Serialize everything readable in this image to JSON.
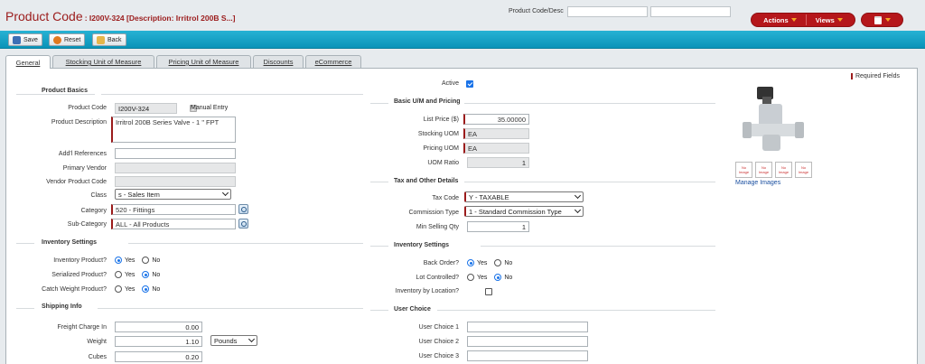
{
  "header": {
    "title": "Product Code",
    "subtitle": ": I200V-324 [Description: Irritrol 200B S...]",
    "search_label": "Product Code/Desc",
    "search_value_1": "",
    "search_value_2": ""
  },
  "actions": {
    "actions_label": "Actions",
    "views_label": "Views"
  },
  "toolbar": {
    "save": "Save",
    "reset": "Reset",
    "back": "Back"
  },
  "tabs": [
    "General",
    "Stocking Unit of Measure",
    "Pricing Unit of Measure",
    "Discounts",
    "eCommerce"
  ],
  "required_note": "Required Fields",
  "active": {
    "label": "Active",
    "checked": true
  },
  "product_basics": {
    "section": "Product Basics",
    "code_label": "Product Code",
    "code": "I200V-324",
    "manual_entry": "Manual Entry",
    "desc_label": "Product Description",
    "desc": "Irritrol 200B Series Valve - 1 \" FPT",
    "refs_label": "Add'l References",
    "refs": "",
    "vendor_label": "Primary Vendor",
    "vendor": "",
    "vpc_label": "Vendor Product Code",
    "vpc": "",
    "class_label": "Class",
    "class": "s - Sales Item",
    "category_label": "Category",
    "category": "520 - Fittings",
    "subcat_label": "Sub-Category",
    "subcat": "ALL - All Products"
  },
  "inv_left": {
    "section": "Inventory Settings",
    "inv_label": "Inventory Product?",
    "ser_label": "Serialized Product?",
    "cw_label": "Catch Weight Product?",
    "yes": "Yes",
    "no": "No",
    "inv": "Yes",
    "ser": "No",
    "cw": "No"
  },
  "shipping": {
    "section": "Shipping Info",
    "freight_label": "Freight Charge In",
    "freight": "0.00",
    "weight_label": "Weight",
    "weight": "1.10",
    "weight_unit": "Pounds",
    "cubes_label": "Cubes",
    "cubes": "0.20"
  },
  "pricing": {
    "section": "Basic U/M and Pricing",
    "list_label": "List Price ($)",
    "list": "35.00000",
    "stock_label": "Stocking UOM",
    "stock": "EA",
    "pricing_label": "Pricing UOM",
    "pricing": "EA",
    "ratio_label": "UOM Ratio",
    "ratio": "1"
  },
  "tax": {
    "section": "Tax and Other Details",
    "tax_label": "Tax Code",
    "tax": "Y - TAXABLE",
    "comm_label": "Commission Type",
    "comm": "1 - Standard Commission Type",
    "min_label": "Min Selling Qty",
    "min": "1"
  },
  "inv_right": {
    "section": "Inventory Settings",
    "bo_label": "Back Order?",
    "lot_label": "Lot Controlled?",
    "loc_label": "Inventory by Location?",
    "yes": "Yes",
    "no": "No",
    "bo": "Yes",
    "lot": "No",
    "loc": false
  },
  "user": {
    "section": "User Choice",
    "u1": "User Choice 1",
    "u2": "User Choice 2",
    "u3": "User Choice 3"
  },
  "images": {
    "manage": "Manage Images",
    "thumb_text": "No Image"
  }
}
